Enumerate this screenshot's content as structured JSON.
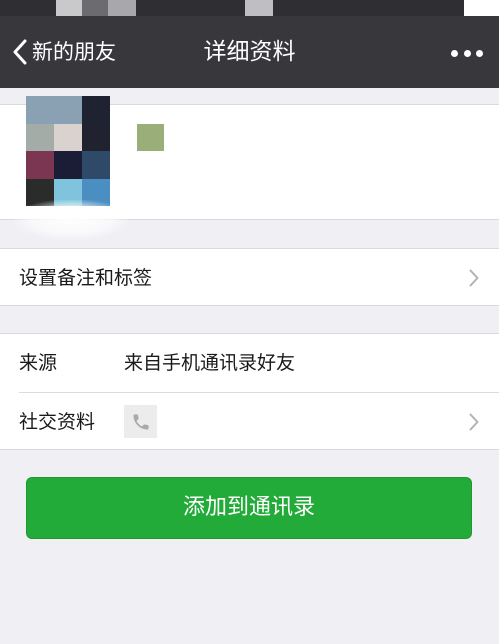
{
  "colors": {
    "nav_background": "#38373c",
    "page_background": "#efeff4",
    "primary_button": "#22ab38",
    "text": "#1a1a1a",
    "chevron": "#b2b2b2"
  },
  "nav": {
    "back_label": "新的朋友",
    "title": "详细资料",
    "back_icon": "chevron-left-icon",
    "more_icon": "more-dots-icon"
  },
  "profile": {
    "avatar_colors": [
      "#8aa0b3",
      "#8aa0b3",
      "#1f2230",
      "#a4aca8",
      "#d9d2cf",
      "#20232f",
      "#7b3751",
      "#1a1d35",
      "#2f4a68",
      "#2a2c2b",
      "#7fc4dc",
      "#4b8fc2"
    ],
    "nickname_color": "#9aae7a"
  },
  "remark": {
    "label": "设置备注和标签"
  },
  "info": {
    "source_label": "来源",
    "source_value": "来自手机通讯录好友",
    "social_label": "社交资料",
    "social_icon": "phone-icon"
  },
  "actions": {
    "add_label": "添加到通讯录"
  }
}
